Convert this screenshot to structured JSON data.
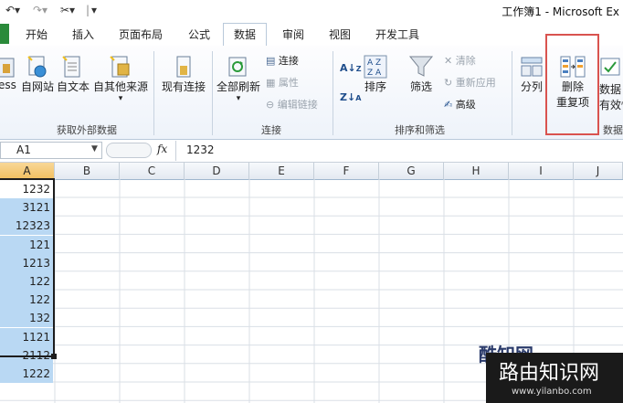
{
  "window": {
    "title": "工作簿1 - Microsoft Ex"
  },
  "quick_access": {
    "undo_icon": "undo-arrow",
    "redo_icon": "redo-arrow",
    "customize_icon": "dropdown-arrow"
  },
  "tabs": [
    "开始",
    "插入",
    "页面布局",
    "公式",
    "数据",
    "审阅",
    "视图",
    "开发工具"
  ],
  "active_tab": "数据",
  "ribbon": {
    "get_external": {
      "label": "获取外部数据",
      "buttons": [
        "ess",
        "自网站",
        "自文本",
        "自其他来源",
        "现有连接"
      ]
    },
    "connections": {
      "label": "连接",
      "refresh_all": "全部刷新",
      "connections": "连接",
      "properties": "属性",
      "edit_links": "编辑链接"
    },
    "sort_filter": {
      "label": "排序和筛选",
      "sort": "排序",
      "filter": "筛选",
      "clear": "清除",
      "reapply": "重新应用",
      "advanced": "高级"
    },
    "data_tools": {
      "label": "数据",
      "text_to_columns": "分列",
      "remove_dup_line1": "删除",
      "remove_dup_line2": "重复项",
      "validation_line1": "数据",
      "validation_line2": "有效性"
    }
  },
  "formula_bar": {
    "name_box": "A1",
    "fx": "fx",
    "value": "1232"
  },
  "columns": [
    "A",
    "B",
    "C",
    "D",
    "E",
    "F",
    "G",
    "H",
    "I",
    "J"
  ],
  "cells_a": [
    "1232",
    "3121",
    "12323",
    "121",
    "1213",
    "122",
    "122",
    "132",
    "1121",
    "2112",
    "1222"
  ],
  "watermark": {
    "logo": "酷知网",
    "text": "路由知识网",
    "url": "www.yilanbo.com"
  },
  "colors": {
    "highlight": "#d9534f",
    "selection": "#b9d8f3",
    "active_col_header": "#f2c060"
  }
}
